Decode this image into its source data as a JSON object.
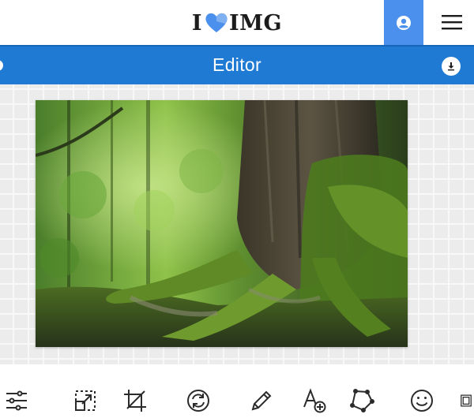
{
  "app": {
    "logo_left": "I",
    "logo_right": "IMG",
    "brand_color": "#4a90ec",
    "bar_color": "#1f7ad3"
  },
  "header": {
    "user_icon": "user-circle-icon",
    "menu_icon": "hamburger-menu-icon"
  },
  "editor": {
    "title": "Editor",
    "download_icon": "download-icon"
  },
  "toolbar": {
    "tools": [
      {
        "name": "adjust-sliders-icon"
      },
      {
        "name": "resize-icon"
      },
      {
        "name": "crop-icon"
      },
      {
        "name": "rotate-icon"
      },
      {
        "name": "draw-pencil-icon"
      },
      {
        "name": "add-text-icon"
      },
      {
        "name": "shape-icon"
      },
      {
        "name": "emoji-sticker-icon"
      },
      {
        "name": "frame-icon"
      }
    ]
  }
}
